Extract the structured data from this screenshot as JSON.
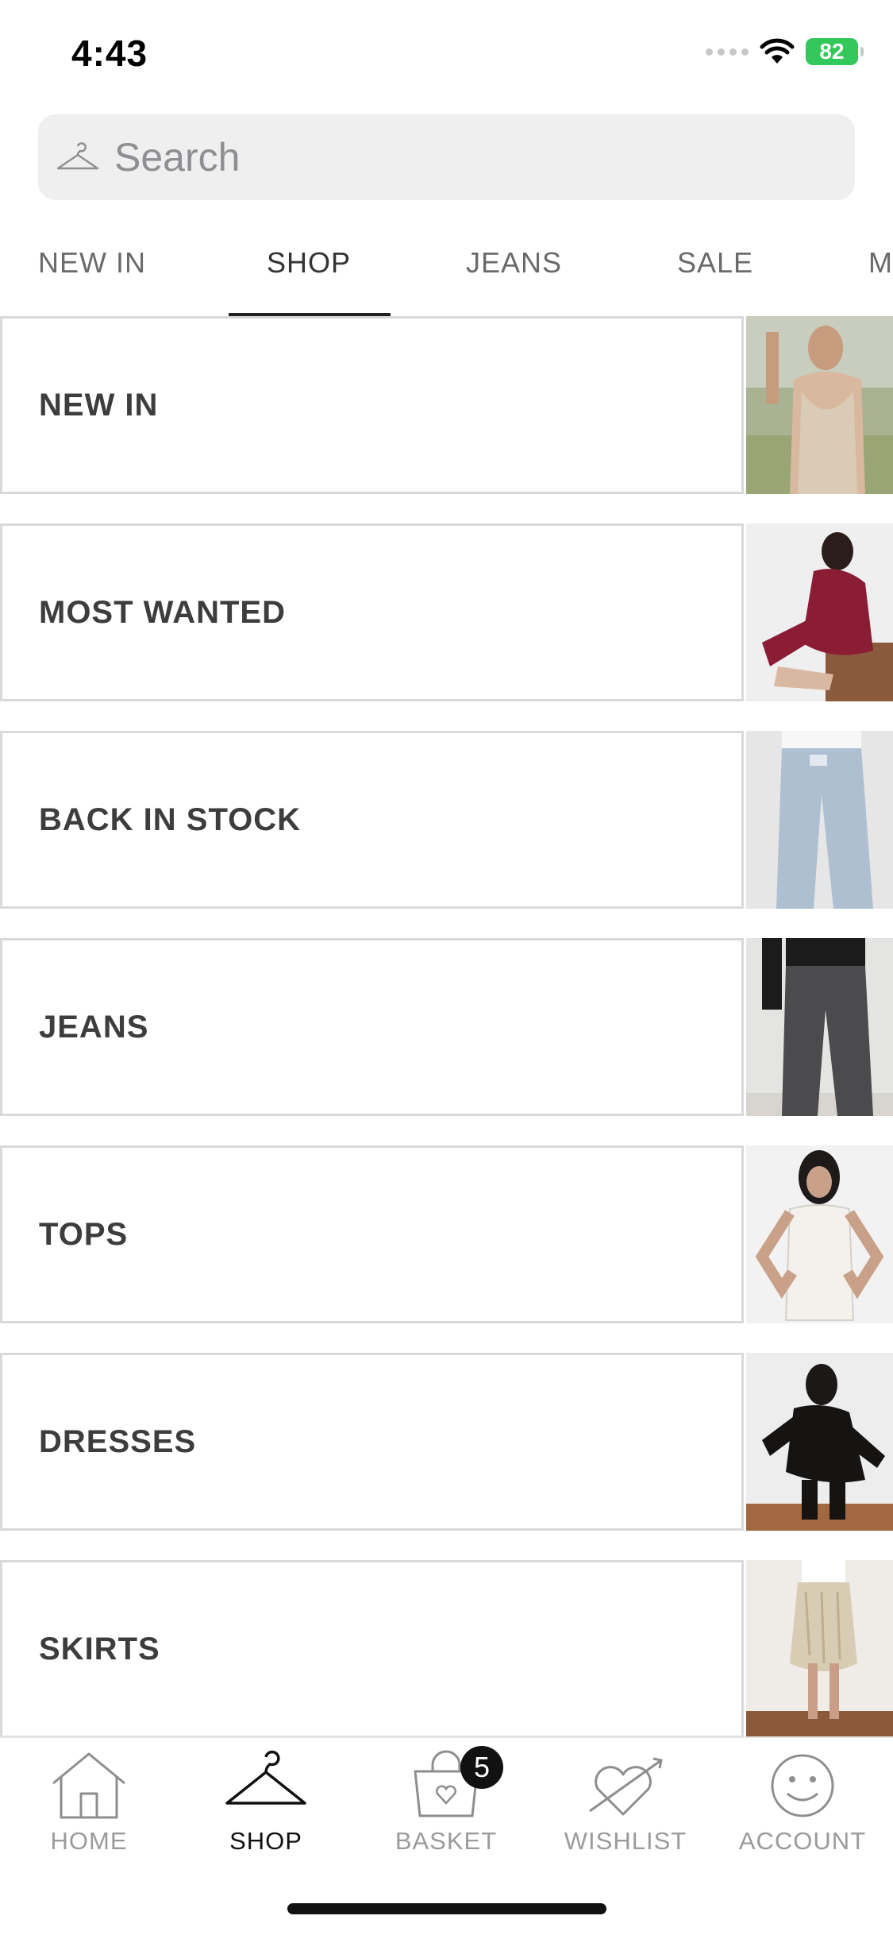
{
  "status_bar": {
    "time": "4:43",
    "battery": "82"
  },
  "search": {
    "placeholder": "Search"
  },
  "tabs": [
    {
      "label": "NEW IN",
      "active": false
    },
    {
      "label": "SHOP",
      "active": true
    },
    {
      "label": "JEANS",
      "active": false
    },
    {
      "label": "SALE",
      "active": false
    },
    {
      "label": "M",
      "active": false
    }
  ],
  "categories": [
    {
      "label": "NEW IN"
    },
    {
      "label": "MOST WANTED"
    },
    {
      "label": "BACK IN STOCK"
    },
    {
      "label": "JEANS"
    },
    {
      "label": "TOPS"
    },
    {
      "label": "DRESSES"
    },
    {
      "label": "SKIRTS"
    }
  ],
  "bottom_nav": [
    {
      "label": "HOME",
      "icon": "home-icon",
      "active": false
    },
    {
      "label": "SHOP",
      "icon": "hanger-icon",
      "active": true
    },
    {
      "label": "BASKET",
      "icon": "basket-icon",
      "active": false,
      "badge": "5"
    },
    {
      "label": "WISHLIST",
      "icon": "heart-arrow-icon",
      "active": false
    },
    {
      "label": "ACCOUNT",
      "icon": "smiley-icon",
      "active": false
    }
  ]
}
